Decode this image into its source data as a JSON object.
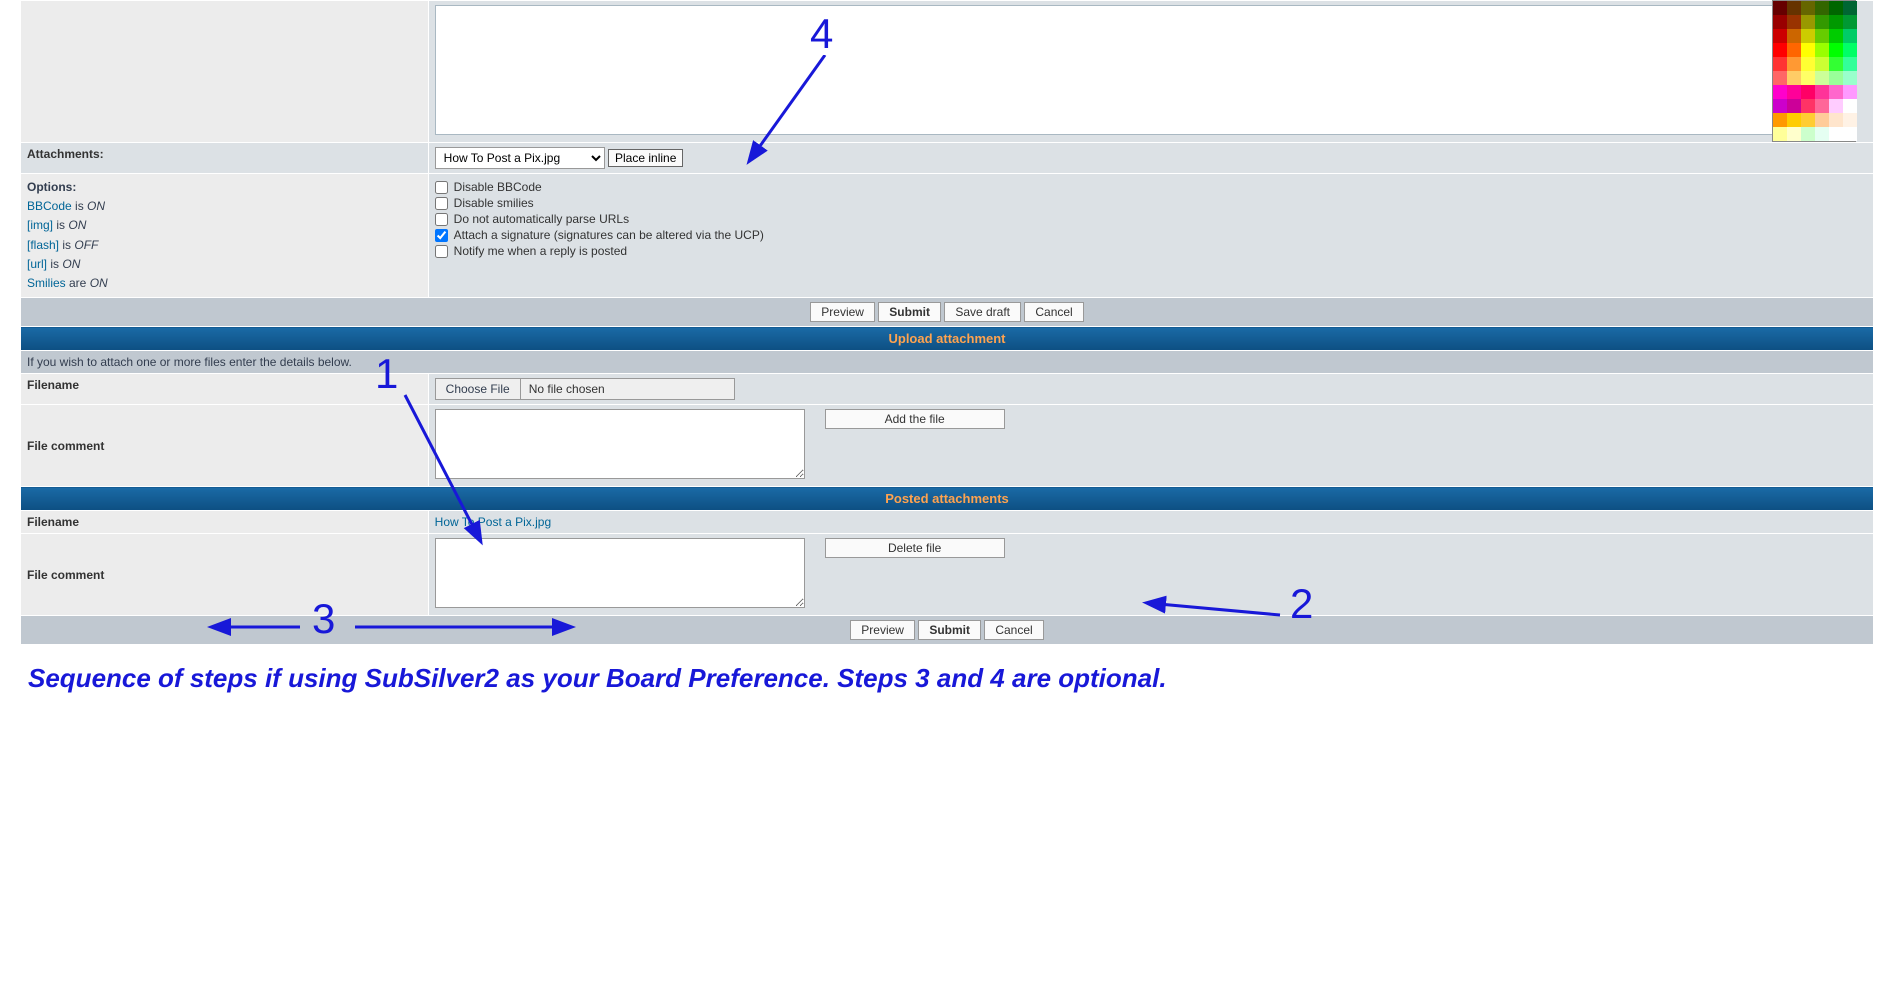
{
  "attachments": {
    "label": "Attachments:",
    "selected_file": "How To Post a Pix.jpg",
    "place_inline": "Place inline"
  },
  "options": {
    "label": "Options:",
    "status": [
      {
        "tag": "BBCode",
        "mid": " is ",
        "state": "ON"
      },
      {
        "tag": "[img]",
        "mid": " is ",
        "state": "ON"
      },
      {
        "tag": "[flash]",
        "mid": " is ",
        "state": "OFF"
      },
      {
        "tag": "[url]",
        "mid": " is ",
        "state": "ON"
      },
      {
        "tag": "Smilies",
        "mid": " are ",
        "state": "ON"
      }
    ],
    "checkboxes": [
      {
        "label": "Disable BBCode",
        "checked": false
      },
      {
        "label": "Disable smilies",
        "checked": false
      },
      {
        "label": "Do not automatically parse URLs",
        "checked": false
      },
      {
        "label": "Attach a signature (signatures can be altered via the UCP)",
        "checked": true
      },
      {
        "label": "Notify me when a reply is posted",
        "checked": false
      }
    ]
  },
  "buttons_top": {
    "preview": "Preview",
    "submit": "Submit",
    "save_draft": "Save draft",
    "cancel": "Cancel"
  },
  "upload": {
    "header": "Upload attachment",
    "info": "If you wish to attach one or more files enter the details below.",
    "filename_label": "Filename",
    "choose_file": "Choose File",
    "no_file": "No file chosen",
    "comment_label": "File comment",
    "add_file": "Add the file"
  },
  "posted": {
    "header": "Posted attachments",
    "filename_label": "Filename",
    "filename_value": "How To Post a Pix.jpg",
    "comment_label": "File comment",
    "delete_file": "Delete file"
  },
  "buttons_bottom": {
    "preview": "Preview",
    "submit": "Submit",
    "cancel": "Cancel"
  },
  "caption": "Sequence of steps if using SubSilver2 as your Board Preference.  Steps 3 and 4 are optional.",
  "annotations": {
    "n1": "1",
    "n2": "2",
    "n3": "3",
    "n4": "4"
  },
  "palette": [
    "#660000",
    "#663300",
    "#666600",
    "#336600",
    "#006600",
    "#006633",
    "#990000",
    "#993300",
    "#999900",
    "#339900",
    "#009900",
    "#009933",
    "#CC0000",
    "#CC6600",
    "#CCCC00",
    "#66CC00",
    "#00CC00",
    "#00CC66",
    "#FF0000",
    "#FF6600",
    "#FFFF00",
    "#99FF00",
    "#00FF00",
    "#00FF66",
    "#FF3333",
    "#FF9933",
    "#FFFF33",
    "#CCFF33",
    "#33FF33",
    "#33FF99",
    "#FF6666",
    "#FFCC66",
    "#FFFF66",
    "#CCFF99",
    "#99FF99",
    "#99FFCC",
    "#FF00CC",
    "#FF0099",
    "#FF0066",
    "#FF3399",
    "#FF66CC",
    "#FF99FF",
    "#CC00CC",
    "#CC0099",
    "#FF3366",
    "#FF6699",
    "#FFCCFF",
    "#FFFFFF",
    "#FF9900",
    "#FFCC00",
    "#FFCC33",
    "#FFCC99",
    "#FFE5CC",
    "#FFF2E5",
    "#FFFF99",
    "#FFFFCC",
    "#CCFFCC",
    "#E5FFF2",
    "#FFFFFF",
    "#FFFFFF"
  ]
}
